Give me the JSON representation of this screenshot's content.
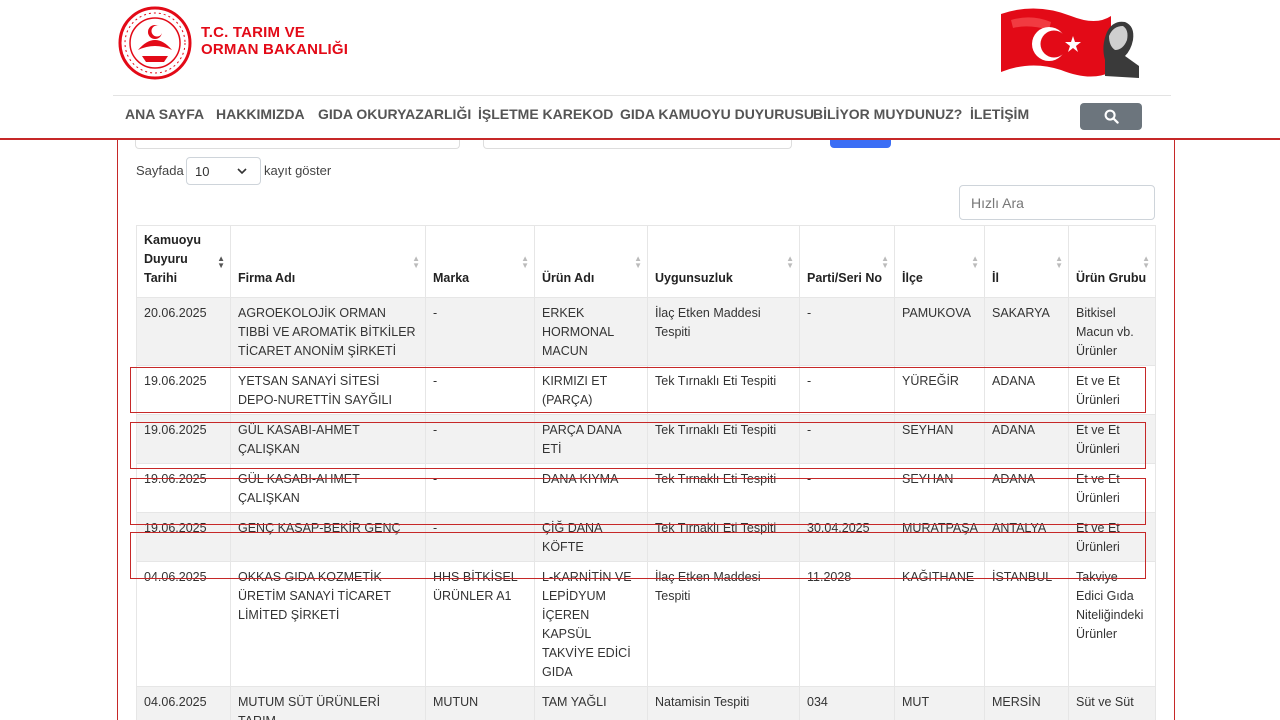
{
  "header": {
    "brand_line1": "T.C. TARIM VE",
    "brand_line2": "ORMAN BAKANLIĞI"
  },
  "nav": {
    "items": [
      "ANA SAYFA",
      "HAKKIMIZDA",
      "GIDA OKURYAZARLIĞI",
      "İŞLETME KAREKOD",
      "GIDA KAMUOYU DUYURUSU",
      "BİLİYOR MUYDUNUZ?",
      "İLETİŞİM"
    ],
    "search_icon": "search-icon"
  },
  "controls": {
    "length_prefix": "Sayfada",
    "length_value": "10",
    "length_suffix": "kayıt göster",
    "quick_search_placeholder": "Hızlı Ara"
  },
  "colors": {
    "brand_red": "#e30a17",
    "highlight_border": "#c62828",
    "search_button": "#6c757d"
  },
  "table": {
    "columns": [
      {
        "label": "Kamuoyu Duyuru Tarihi",
        "sorted": "desc"
      },
      {
        "label": "Firma Adı"
      },
      {
        "label": "Marka"
      },
      {
        "label": "Ürün Adı"
      },
      {
        "label": "Uygunsuzluk"
      },
      {
        "label": "Parti/Seri No"
      },
      {
        "label": "İlçe"
      },
      {
        "label": "İl"
      },
      {
        "label": "Ürün Grubu"
      }
    ],
    "rows": [
      [
        "20.06.2025",
        "AGROEKOLOJİK ORMAN TIBBİ VE AROMATİK BİTKİLER TİCARET ANONİM ŞİRKETİ",
        "-",
        "ERKEK HORMONAL MACUN",
        "İlaç Etken Maddesi Tespiti",
        "-",
        "PAMUKOVA",
        "SAKARYA",
        "Bitkisel Macun vb. Ürünler"
      ],
      [
        "19.06.2025",
        "YETSAN SANAYİ SİTESİ DEPO-NURETTİN SAYĞILI",
        "-",
        "KIRMIZI ET (PARÇA)",
        "Tek Tırnaklı Eti Tespiti",
        "-",
        "YÜREĞİR",
        "ADANA",
        "Et ve Et Ürünleri"
      ],
      [
        "19.06.2025",
        "GÜL KASABI-AHMET ÇALIŞKAN",
        "-",
        "PARÇA DANA ETİ",
        "Tek Tırnaklı Eti Tespiti",
        "-",
        "SEYHAN",
        "ADANA",
        "Et ve Et Ürünleri"
      ],
      [
        "19.06.2025",
        "GÜL KASABI-AHMET ÇALIŞKAN",
        "-",
        "DANA KIYMA",
        "Tek Tırnaklı Eti Tespiti",
        "-",
        "SEYHAN",
        "ADANA",
        "Et ve Et Ürünleri"
      ],
      [
        "19.06.2025",
        "GENÇ KASAP-BEKİR GENÇ",
        "-",
        "ÇİĞ DANA KÖFTE",
        "Tek Tırnaklı Eti Tespiti",
        "30.04.2025",
        "MURATPAŞA",
        "ANTALYA",
        "Et ve Et Ürünleri"
      ],
      [
        "04.06.2025",
        "OKKAS GIDA KOZMETİK ÜRETİM SANAYİ TİCARET LİMİTED ŞİRKETİ",
        "HHS BİTKİSEL ÜRÜNLER A1",
        "L-KARNİTİN VE LEPİDYUM İÇEREN KAPSÜL TAKVİYE EDİCİ GIDA",
        "İlaç Etken Maddesi Tespiti",
        "11.2028",
        "KAĞITHANE",
        "İSTANBUL",
        "Takviye Edici Gıda Niteliğindeki Ürünler"
      ],
      [
        "04.06.2025",
        "MUTUM SÜT ÜRÜNLERİ TARIM",
        "MUTUN",
        "TAM YAĞLI",
        "Natamisin Tespiti",
        "034",
        "MUT",
        "MERSİN",
        "Süt ve Süt"
      ]
    ]
  }
}
